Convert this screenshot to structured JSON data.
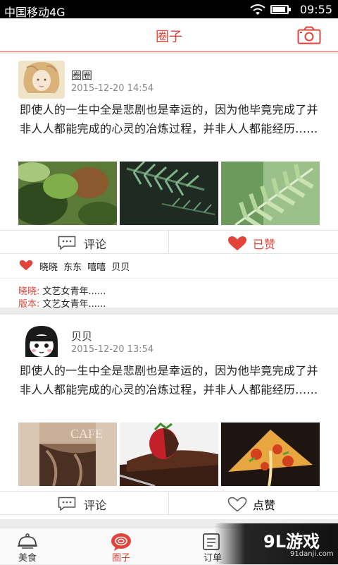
{
  "status_bar": {
    "carrier": "中国移动4G",
    "time": "09:55"
  },
  "header": {
    "title": "圈子",
    "camera_icon": "camera-icon"
  },
  "posts": [
    {
      "username": "圈圈",
      "time": "2015-12-20 14:54",
      "text": "即使人的一生中全是悲剧也是幸运的，因为他毕竟完成了并非人人都能完成的心灵的冶炼过程，并非人人都能经历......",
      "comment_label": "评论",
      "like_label": "已赞",
      "liked": true,
      "likers": "晓晓 东东 嘻嘻 贝贝",
      "comments": [
        {
          "who": "晓晓:",
          "text": "文艺女青年......"
        },
        {
          "who": "版本:",
          "text": "文艺女青年......"
        }
      ]
    },
    {
      "username": "贝贝",
      "time": "2015-12-20 13:54",
      "text": "即使人的一生中全是悲剧也是幸运的，因为他毕竟完成了并非人人都能完成的心灵的冶炼过程，并非人人都能经历......",
      "comment_label": "评论",
      "like_label": "点赞",
      "liked": false,
      "photo_caption": "CAFE"
    }
  ],
  "tabs": [
    {
      "label": "美食",
      "icon": "cloche-icon"
    },
    {
      "label": "圈子",
      "icon": "chat-bubble-icon",
      "active": true
    },
    {
      "label": "订单",
      "icon": "order-list-icon"
    }
  ],
  "watermark": {
    "logo": "9L游戏",
    "site": "91danji.com"
  },
  "colors": {
    "accent": "#e2443a",
    "header_line": "#e8a19a"
  }
}
